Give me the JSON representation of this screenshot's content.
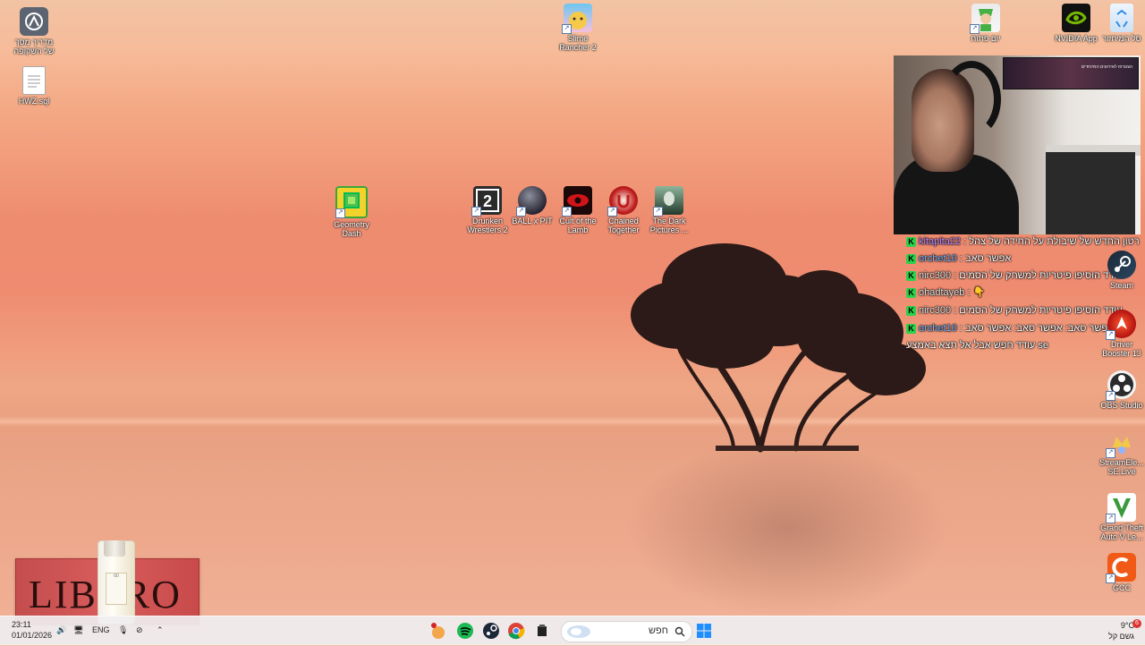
{
  "desktop": {
    "icons_left": [
      {
        "label": "מדריך מסך של השקופה",
        "name": "overlay-guide-icon"
      },
      {
        "label": "HWZ.sql",
        "name": "sql-file-icon"
      }
    ],
    "icons_top": [
      {
        "label": "Slime Rancher 2",
        "name": "slime-rancher-icon"
      },
      {
        "label": "Geometry Dash",
        "name": "geometry-dash-icon"
      },
      {
        "label": "Drunken Wrestlers 2",
        "name": "drunken-wrestlers-icon"
      },
      {
        "label": "BALL x PIT",
        "name": "ball-x-pit-icon"
      },
      {
        "label": "Cult of the Lamb",
        "name": "cult-of-the-lamb-icon"
      },
      {
        "label": "Chained Together",
        "name": "chained-together-icon"
      },
      {
        "label": "The Dark Pictures ...",
        "name": "dark-pictures-icon"
      }
    ],
    "icons_right_top": [
      {
        "label": "יום פתוח",
        "name": "character-app-icon"
      },
      {
        "label": "NVIDIA App",
        "name": "nvidia-icon"
      },
      {
        "label": "סל המיחזור",
        "name": "recycle-bin-icon"
      }
    ],
    "icons_right": [
      {
        "label": "Steam",
        "name": "steam-icon"
      },
      {
        "label": "Driver Booster 13",
        "name": "driver-booster-icon"
      },
      {
        "label": "OBS Studio",
        "name": "obs-icon"
      },
      {
        "label": "StreamEle... SE.Live",
        "name": "streamelements-icon"
      },
      {
        "label": "Grand Theft Auto V Le...",
        "name": "gta-icon"
      },
      {
        "label": "GCC",
        "name": "gcc-icon"
      }
    ]
  },
  "webcam": {
    "tv_text": "הצטרפו לאירועים המיוחדים"
  },
  "chat": {
    "messages": [
      {
        "user": "kitapita22",
        "text": "רטון החדש של שיבולת על החידה של צהל",
        "badge": "K",
        "user_color": "purple"
      },
      {
        "user": "orchet10",
        "text": "אפשר סאב",
        "badge": "K",
        "user_color": "blue"
      },
      {
        "user": "nirc300",
        "text": "עודד הוסיפו פיטריות למשחק של הסמים",
        "badge": "K",
        "user_color": "white"
      },
      {
        "user": "ohadtayeb",
        "text": "👇",
        "badge": "K",
        "user_color": "white"
      },
      {
        "user": "nirc300",
        "text": "עודד הוסיפו פיטריות למשחק של הסמים",
        "badge": "K",
        "user_color": "white"
      },
      {
        "user": "orchet10",
        "text": "אפשר סאב: אפשר סאב: אפשר סאב",
        "badge": "K",
        "user_color": "blue"
      },
      {
        "user": "",
        "text": "עודד חפש אבל אל תצא באמצע se",
        "badge": "",
        "user_color": "white"
      }
    ]
  },
  "ad": {
    "brand": "LIBERO",
    "bottle_label": "60"
  },
  "taskbar": {
    "time": "23:11",
    "date": "01/01/2026",
    "language": "ENG",
    "search_placeholder": "חפש",
    "weather_temp": "9°C",
    "weather_desc": "גשם קל",
    "notification_count": "6"
  }
}
